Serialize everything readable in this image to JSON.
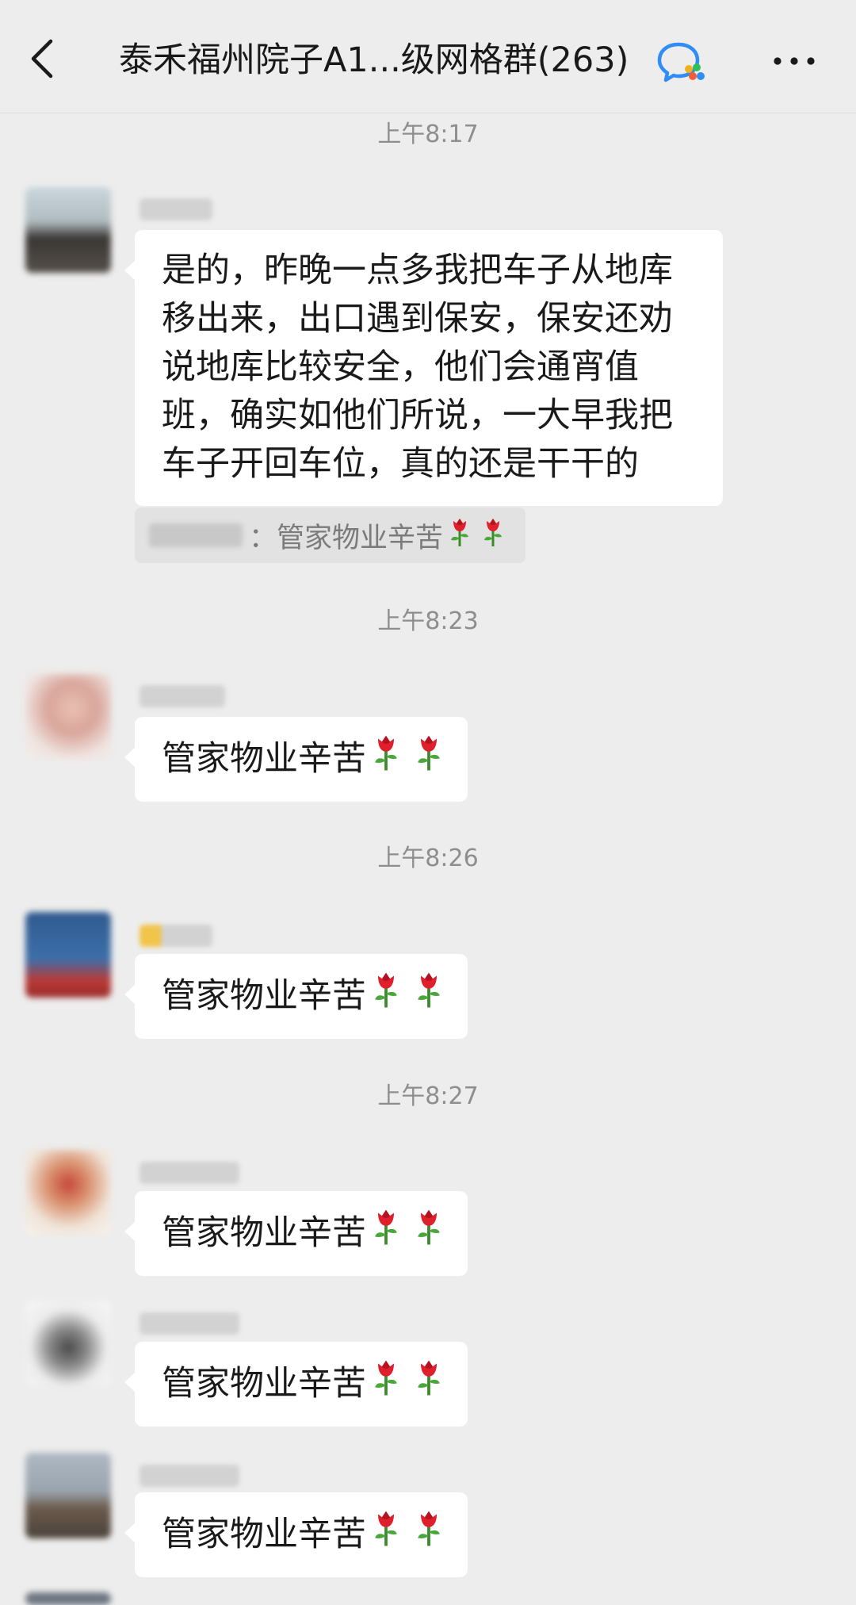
{
  "header": {
    "title": "泰禾福州院子A1...级网格群(263)",
    "back_icon": "chevron-left-icon",
    "app_icon": "wecom-chat-icon",
    "more_icon": "more-dots-icon"
  },
  "colors": {
    "background": "#ededed",
    "bubble": "#ffffff",
    "quote": "#e2e2e2",
    "timestamp": "#8e8e8e"
  },
  "messages": [
    {
      "time": "上午8:17",
      "text": "是的，昨晚一点多我把车子从地库移出来，出口遇到保安，保安还劝说地库比较安全，他们会通宵值班，确实如他们所说，一大早我把车子开回车位，真的还是干干的",
      "quote_separator": "：",
      "quote_text": "管家物业辛苦"
    },
    {
      "time": "上午8:23",
      "text": "管家物业辛苦"
    },
    {
      "time": "上午8:26",
      "text": "管家物业辛苦"
    },
    {
      "time": "上午8:27",
      "text": "管家物业辛苦"
    },
    {
      "text": "管家物业辛苦"
    },
    {
      "text": "管家物业辛苦"
    }
  ],
  "emoji": "rose-icon"
}
